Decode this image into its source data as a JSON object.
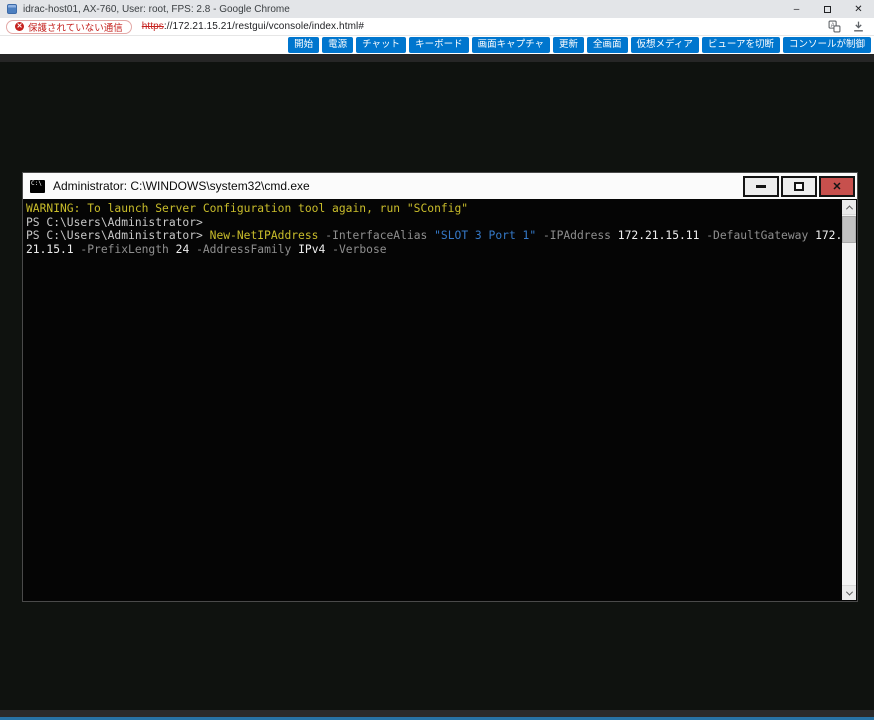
{
  "browser": {
    "window_title": "idrac-host01, AX-760, User: root, FPS: 2.8 - Google Chrome",
    "controls": {
      "minimize": "–",
      "close": "✕"
    },
    "urlbar": {
      "security_badge_label": "保護されていない通信",
      "security_badge_icon": "✕",
      "url_scheme": "https",
      "url_rest": "://172.21.15.21/restgui/vconsole/index.html#"
    }
  },
  "toolbar": {
    "buttons": [
      "開始",
      "電源",
      "チャット",
      "キーボード",
      "画面キャプチャ",
      "更新",
      "全画面",
      "仮想メディア",
      "ビューアを切断",
      "コンソールが制御"
    ]
  },
  "console_window": {
    "title": "Administrator: C:\\WINDOWS\\system32\\cmd.exe",
    "icon_label": "C:\\",
    "controls": {
      "minimize": "–",
      "close": "✕"
    },
    "terminal": {
      "lines": [
        [
          [
            "yellow",
            "WARNING: To launch Server Configuration tool again, run \"SConfig\""
          ]
        ],
        [
          [
            "fg",
            "PS C:\\Users\\Administrator>"
          ]
        ],
        [
          [
            "fg",
            "PS C:\\Users\\Administrator> "
          ],
          [
            "yellow",
            "New-NetIPAddress"
          ],
          [
            "fg",
            " "
          ],
          [
            "gray",
            "-InterfaceAlias"
          ],
          [
            "fg",
            " "
          ],
          [
            "blue",
            "\"SLOT 3 Port 1\""
          ],
          [
            "fg",
            " "
          ],
          [
            "gray",
            "-IPAddress"
          ],
          [
            "fg",
            " "
          ],
          [
            "white",
            "172.21.15.11"
          ],
          [
            "fg",
            " "
          ],
          [
            "gray",
            "-DefaultGateway"
          ],
          [
            "fg",
            " "
          ],
          [
            "white",
            "172."
          ]
        ],
        [
          [
            "white",
            "21.15.1"
          ],
          [
            "fg",
            " "
          ],
          [
            "gray",
            "-PrefixLength"
          ],
          [
            "fg",
            " "
          ],
          [
            "white",
            "24"
          ],
          [
            "fg",
            " "
          ],
          [
            "gray",
            "-AddressFamily"
          ],
          [
            "fg",
            " "
          ],
          [
            "white",
            "IPv4"
          ],
          [
            "fg",
            " "
          ],
          [
            "gray",
            "-Verbose"
          ]
        ]
      ]
    }
  },
  "colors": {
    "toolbar_button": "#0076CE",
    "close_button": "#C7504D",
    "terminal": {
      "bg": "#050505",
      "fg": "#C8C8C8",
      "yellow": "#C9BD2B",
      "gray": "#8F8F8F",
      "blue": "#3579C8",
      "white": "#EFEFEF"
    }
  }
}
